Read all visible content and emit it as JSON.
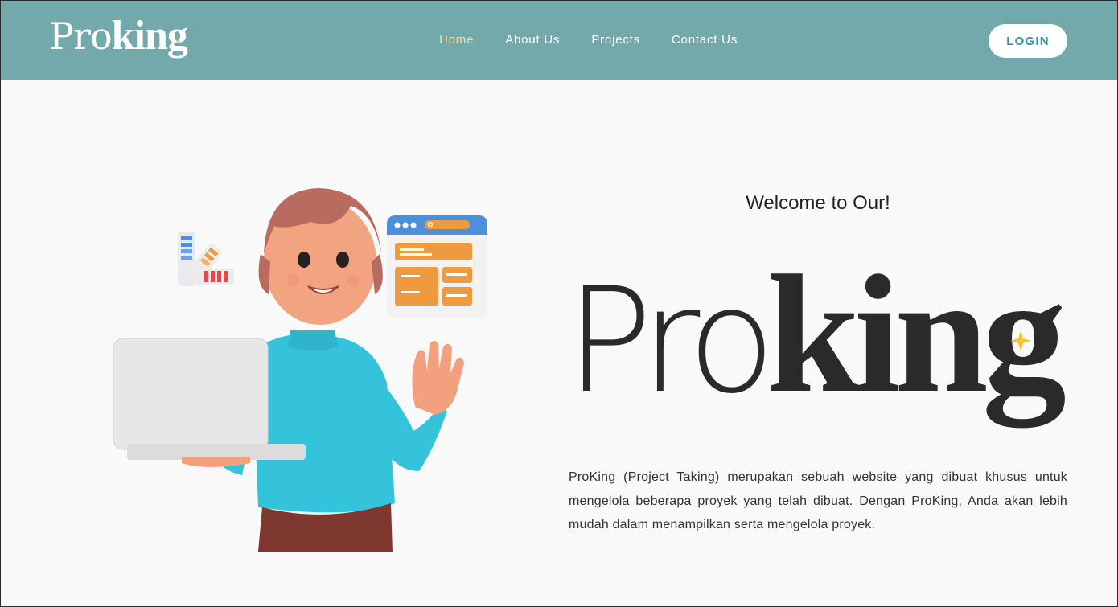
{
  "brand": {
    "name_light": "Pro",
    "name_bold": "king"
  },
  "nav": {
    "items": [
      {
        "label": "Home",
        "active": true
      },
      {
        "label": "About Us",
        "active": false
      },
      {
        "label": "Projects",
        "active": false
      },
      {
        "label": "Contact Us",
        "active": false
      }
    ],
    "login_label": "LOGIN"
  },
  "hero": {
    "welcome": "Welcome to Our!",
    "logo_light": "Pro",
    "logo_bold": "king",
    "description": "ProKing (Project Taking) merupakan sebuah website yang dibuat khusus untuk mengelola beberapa proyek yang telah dibuat. Dengan ProKing, Anda akan lebih mudah dalam menampilkan serta mengelola proyek."
  },
  "colors": {
    "navbar": "#74a9ac",
    "nav_active": "#f4dd9a",
    "login_text": "#2a9aa7",
    "sweater": "#35c3dc",
    "accent_orange": "#ef9a3e",
    "sparkle": "#f2c43d"
  },
  "icons": [
    "sparkle-icon",
    "search-icon",
    "palette-swatch-icon",
    "browser-window-icon",
    "laptop-icon"
  ]
}
